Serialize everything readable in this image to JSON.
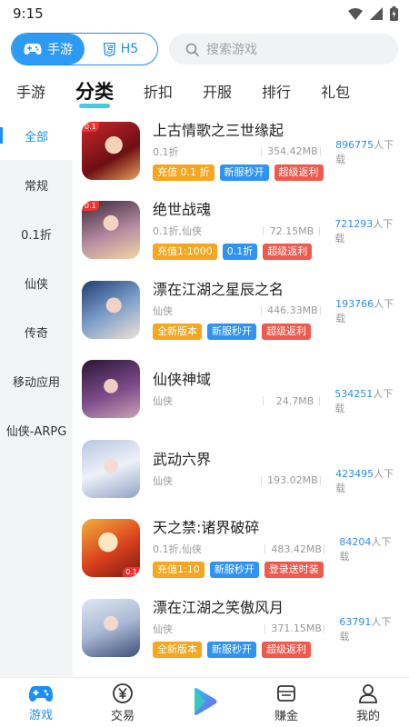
{
  "status": {
    "time": "9:15"
  },
  "topbar": {
    "mobile_label": "手游",
    "h5_label": "H5",
    "search_placeholder": "搜索游戏"
  },
  "tabs": [
    {
      "label": "手游"
    },
    {
      "label": "分类"
    },
    {
      "label": "折扣"
    },
    {
      "label": "开服"
    },
    {
      "label": "排行"
    },
    {
      "label": "礼包"
    }
  ],
  "sidebar": [
    {
      "label": "全部"
    },
    {
      "label": "常规"
    },
    {
      "label": "0.1折"
    },
    {
      "label": "仙侠"
    },
    {
      "label": "传奇"
    },
    {
      "label": "移动应用"
    },
    {
      "label": "仙侠-ARPG"
    }
  ],
  "games": [
    {
      "name": "上古情歌之三世缘起",
      "category": "0.1折",
      "size": "354.42MB",
      "downloads": "896775",
      "dl_suffix": "人下载",
      "tags": [
        {
          "text": "充值 0.1 折",
          "color": "orange"
        },
        {
          "text": "新服秒开",
          "color": "blue"
        },
        {
          "text": "超级返利",
          "color": "red"
        }
      ]
    },
    {
      "name": "绝世战魂",
      "category": "0.1折,仙侠",
      "size": "72.15MB",
      "downloads": "721293",
      "dl_suffix": "人下载",
      "tags": [
        {
          "text": "充值1:1000",
          "color": "orange"
        },
        {
          "text": "0.1折",
          "color": "blue"
        },
        {
          "text": "超级返利",
          "color": "red"
        }
      ]
    },
    {
      "name": "漂在江湖之星辰之名",
      "category": "仙侠",
      "size": "446.33MB",
      "downloads": "193766",
      "dl_suffix": "人下载",
      "tags": [
        {
          "text": "全新版本",
          "color": "orange"
        },
        {
          "text": "新服秒开",
          "color": "blue"
        },
        {
          "text": "超级返利",
          "color": "red"
        }
      ]
    },
    {
      "name": "仙侠神域",
      "category": "仙侠",
      "size": "24.7MB",
      "downloads": "534251",
      "dl_suffix": "人下载",
      "tags": []
    },
    {
      "name": "武动六界",
      "category": "仙侠",
      "size": "193.02MB",
      "downloads": "423495",
      "dl_suffix": "人下载",
      "tags": []
    },
    {
      "name": "天之禁:诸界破碎",
      "category": "0.1折,仙侠",
      "size": "483.42MB",
      "downloads": "84204",
      "dl_suffix": "人下载",
      "tags": [
        {
          "text": "充值1:10",
          "color": "orange"
        },
        {
          "text": "新服秒开",
          "color": "blue"
        },
        {
          "text": "登录送时装",
          "color": "red"
        }
      ]
    },
    {
      "name": "漂在江湖之笑傲风月",
      "category": "仙侠",
      "size": "371.15MB",
      "downloads": "63791",
      "dl_suffix": "人下载",
      "tags": [
        {
          "text": "全新版本",
          "color": "orange"
        },
        {
          "text": "新服秒开",
          "color": "blue"
        },
        {
          "text": "超级返利",
          "color": "red"
        }
      ]
    }
  ],
  "bottom_nav": [
    {
      "label": "游戏",
      "icon": "gamepad-icon"
    },
    {
      "label": "交易",
      "icon": "trade-yen-icon"
    },
    {
      "label": "",
      "icon": "play-icon"
    },
    {
      "label": "赚金",
      "icon": "wallet-icon"
    },
    {
      "label": "我的",
      "icon": "user-icon"
    }
  ],
  "colors": {
    "accent": "#1a8ff5",
    "orange": "#f6a61f",
    "blue": "#2e93f3",
    "red": "#ef5a4d"
  }
}
